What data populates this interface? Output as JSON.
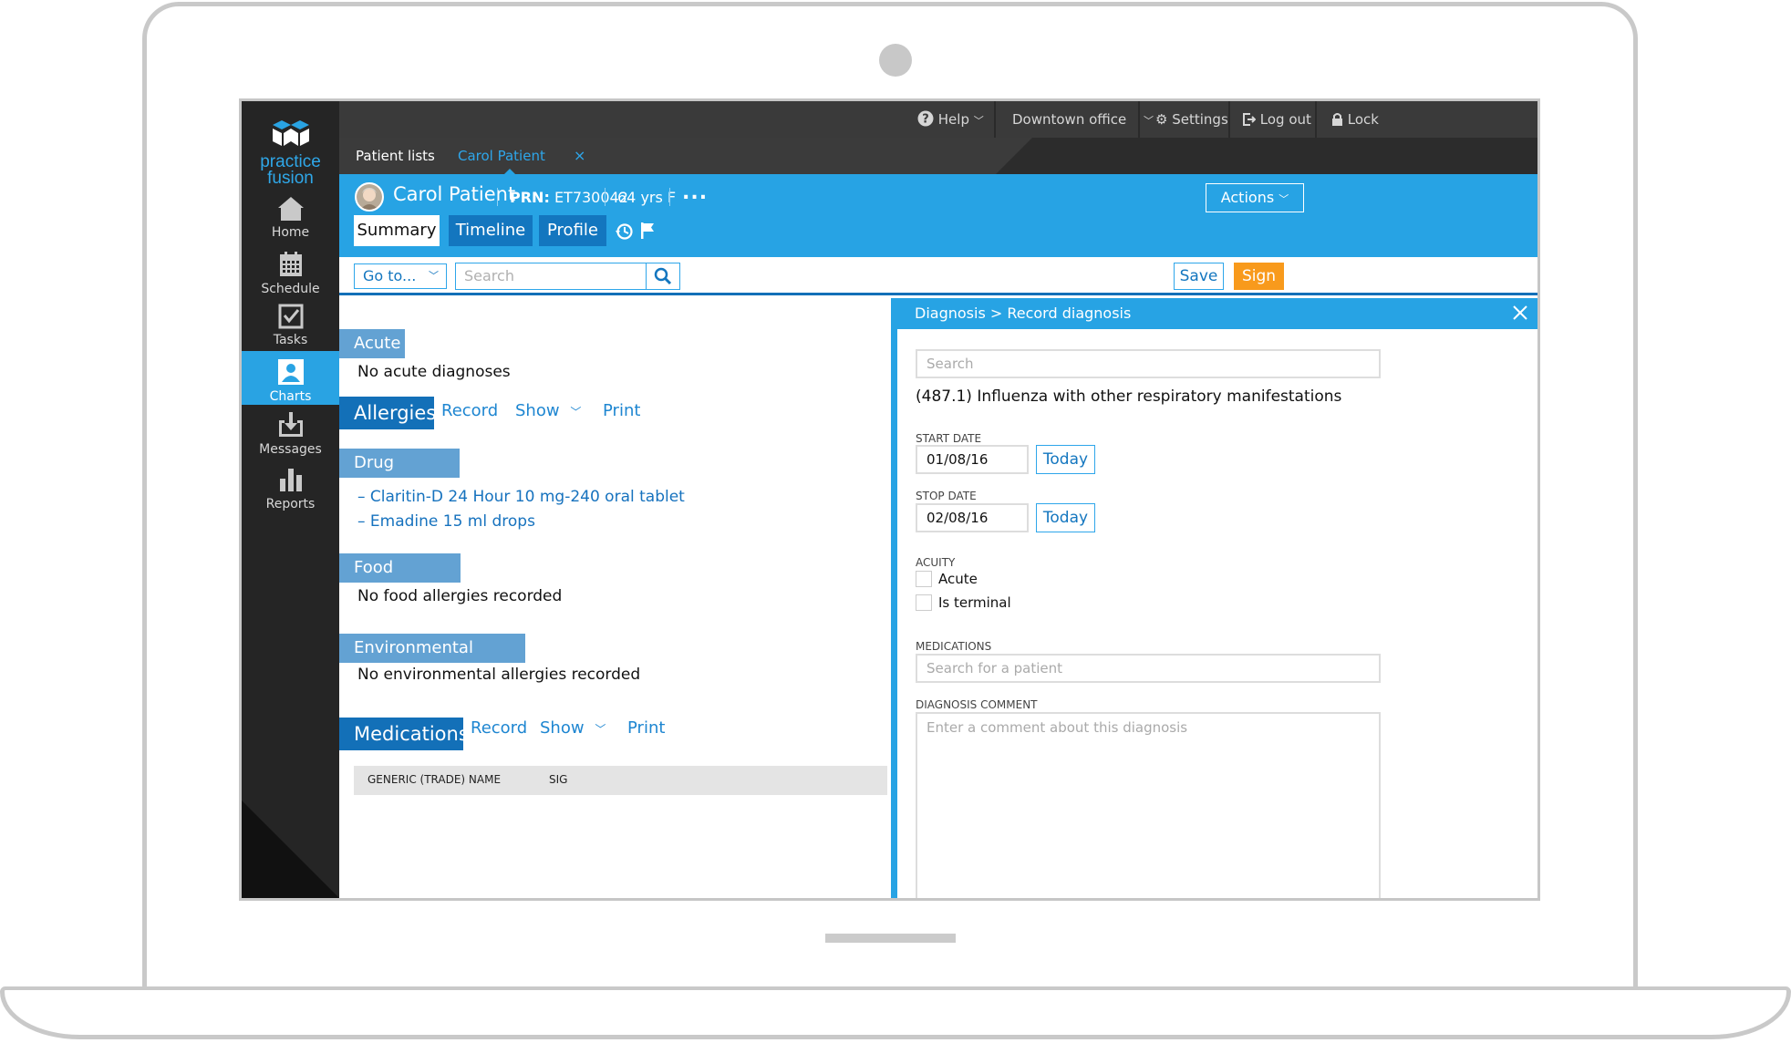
{
  "app": {
    "logo_line1": "practice",
    "logo_line2": "fusion"
  },
  "sidebar": {
    "items": [
      {
        "label": "Home",
        "icon": "home-icon"
      },
      {
        "label": "Schedule",
        "icon": "calendar-icon"
      },
      {
        "label": "Tasks",
        "icon": "checkbox-icon"
      },
      {
        "label": "Charts",
        "icon": "person-icon",
        "active": true
      },
      {
        "label": "Messages",
        "icon": "inbox-download-icon"
      },
      {
        "label": "Reports",
        "icon": "bar-chart-icon"
      }
    ]
  },
  "topbar": {
    "help": "Help",
    "office": "Downtown office",
    "settings": "Settings",
    "logout": "Log out",
    "lock": "Lock"
  },
  "tabs": {
    "patient_lists": "Patient lists",
    "current_patient": "Carol Patient",
    "close": "×"
  },
  "patient": {
    "name": "Carol Patient",
    "prn_label": "PRN:",
    "prn_value": "ET730042",
    "age_sex": "64 yrs F",
    "more": "...",
    "actions": "Actions"
  },
  "patient_tabs": [
    "Summary",
    "Timeline",
    "Profile"
  ],
  "toolbar": {
    "goto": "Go to...",
    "search_placeholder": "Search",
    "save": "Save",
    "sign": "Sign"
  },
  "summary": {
    "acute_heading": "Acute",
    "acute_text": "No acute diagnoses",
    "allergies_heading": "Allergies",
    "allergies_record": "Record",
    "allergies_show": "Show",
    "allergies_print": "Print",
    "drug_heading": "Drug allergies",
    "drug_items": [
      "– Claritin-D 24 Hour 10 mg-240 oral tablet",
      "– Emadine 15 ml drops"
    ],
    "food_heading": "Food allergies",
    "food_text": "No food allergies recorded",
    "env_heading": "Environmental allergies",
    "env_text": "No environmental allergies recorded",
    "meds_heading": "Medications",
    "meds_record": "Record",
    "meds_show": "Show",
    "meds_print": "Print",
    "meds_columns": [
      "GENERIC (TRADE) NAME",
      "SIG"
    ]
  },
  "diagnosis_panel": {
    "title": "Diagnosis > Record diagnosis",
    "search_placeholder": "Search",
    "diagnosis": "(487.1) Influenza with other respiratory manifestations",
    "start_date_label": "START DATE",
    "start_date": "01/08/16",
    "stop_date_label": "STOP DATE",
    "stop_date": "02/08/16",
    "today": "Today",
    "acuity_label": "ACUITY",
    "acuity_options": [
      "Acute",
      "Is terminal"
    ],
    "medications_label": "MEDICATIONS",
    "medications_placeholder": "Search for a patient",
    "comment_label": "DIAGNOSIS COMMENT",
    "comment_placeholder": "Enter a comment about this diagnosis"
  },
  "colors": {
    "brand_blue": "#27a3e4",
    "dark_blue": "#1370b8",
    "sign_orange": "#f89a1c",
    "nav_dark": "#252525"
  }
}
